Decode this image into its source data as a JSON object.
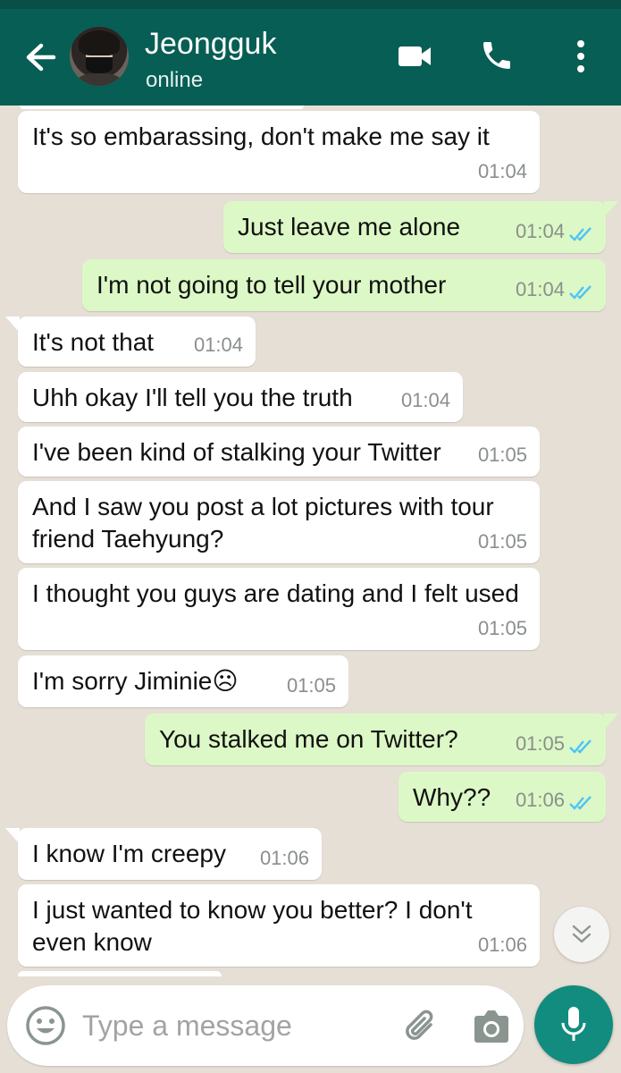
{
  "header": {
    "contact_name": "Jeongguk",
    "status": "online",
    "icons": [
      "back-arrow-icon",
      "avatar",
      "video-call-icon",
      "phone-call-icon",
      "more-options-icon"
    ],
    "color": "#075e54"
  },
  "messages": [
    {
      "dir": "in",
      "text": "It's so embarassing, don't make me say it",
      "time": "01:04"
    },
    {
      "dir": "out",
      "text": "Just leave me alone",
      "time": "01:04",
      "read": true
    },
    {
      "dir": "out",
      "text": "I'm not going to tell your mother",
      "time": "01:04",
      "read": true
    },
    {
      "dir": "in",
      "text": "It's not that",
      "time": "01:04"
    },
    {
      "dir": "in",
      "text": "Uhh okay I'll tell you the truth",
      "time": "01:04"
    },
    {
      "dir": "in",
      "text": "I've been kind of stalking your Twitter",
      "time": "01:05"
    },
    {
      "dir": "in",
      "text": "And I saw you post a lot pictures with tour friend Taehyung?",
      "time": "01:05"
    },
    {
      "dir": "in",
      "text": "I thought you guys are dating and I felt used",
      "time": "01:05"
    },
    {
      "dir": "in",
      "text": "I'm sorry Jiminie☹",
      "time": "01:05"
    },
    {
      "dir": "out",
      "text": "You stalked me on Twitter?",
      "time": "01:05",
      "read": true
    },
    {
      "dir": "out",
      "text": "Why??",
      "time": "01:06",
      "read": true
    },
    {
      "dir": "in",
      "text": "I know I'm creepy",
      "time": "01:06"
    },
    {
      "dir": "in",
      "text": "I just wanted to know you better? I don't even know",
      "time": "01:06"
    }
  ],
  "input": {
    "placeholder": "Type a message",
    "value": ""
  },
  "colors": {
    "incoming": "#ffffff",
    "outgoing": "#dcf8c6",
    "read_ticks": "#4fc3f7",
    "mic_button": "#128c7e"
  }
}
